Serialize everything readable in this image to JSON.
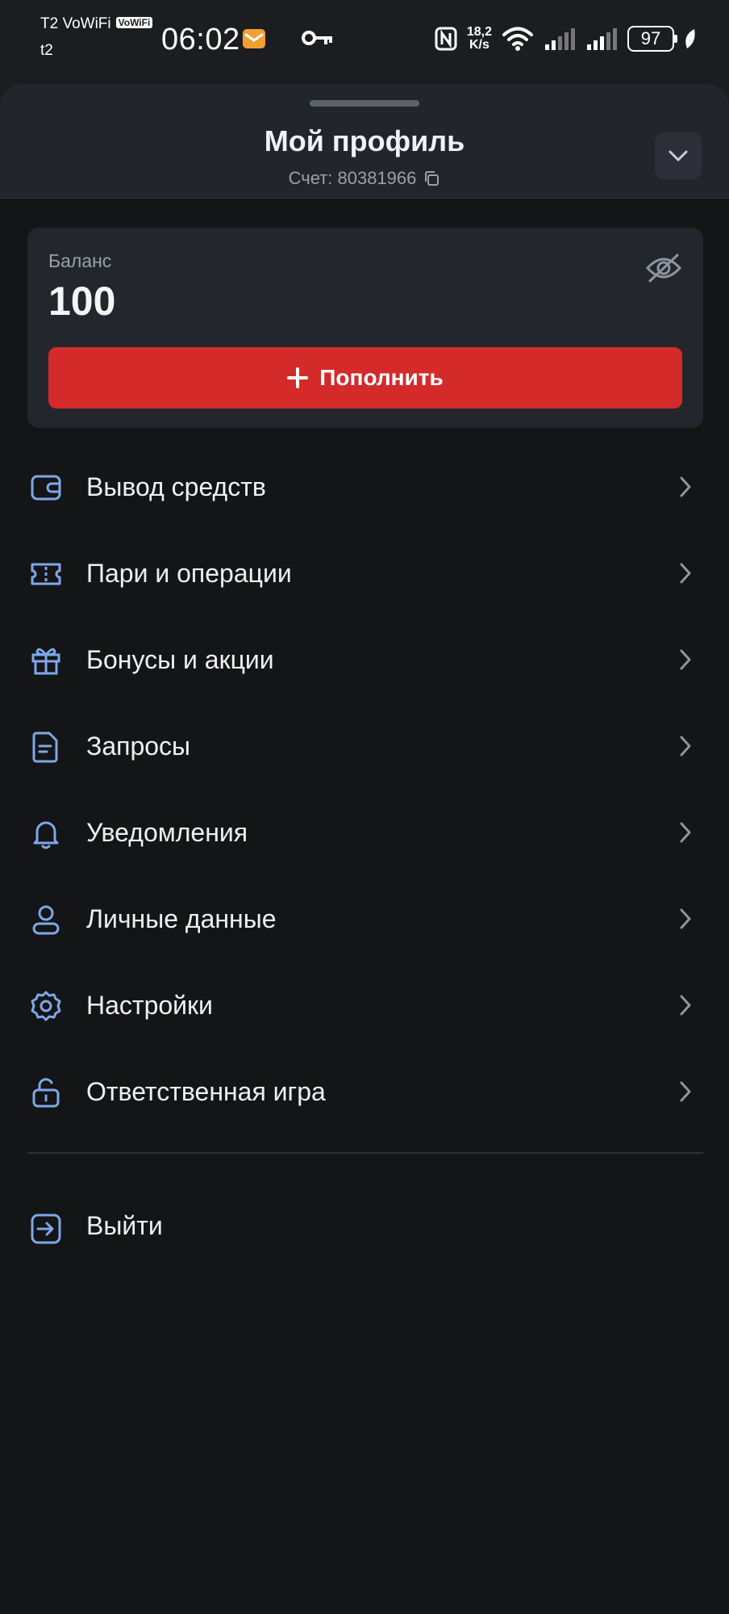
{
  "status_bar": {
    "carrier_line1": "T2 VoWiFi",
    "vowifi_badge": "VoWiFi",
    "carrier_line2": "t2",
    "time": "06:02",
    "net_speed_value": "18,2",
    "net_speed_unit": "K/s",
    "battery": "97",
    "icons": [
      "mail-notification-icon",
      "vpn-key-icon",
      "nfc-icon",
      "wifi-icon",
      "signal-icon",
      "signal-icon",
      "battery-icon",
      "leaf-icon"
    ]
  },
  "header": {
    "title": "Мой профиль",
    "account_label": "Счет: 80381966"
  },
  "balance": {
    "label": "Баланс",
    "value": "100",
    "topup_label": "Пополнить"
  },
  "menu": [
    {
      "label": "Вывод средств",
      "icon": "wallet-icon"
    },
    {
      "label": "Пари и операции",
      "icon": "ticket-icon"
    },
    {
      "label": "Бонусы и акции",
      "icon": "gift-icon"
    },
    {
      "label": "Запросы",
      "icon": "document-icon"
    },
    {
      "label": "Уведомления",
      "icon": "bell-icon"
    },
    {
      "label": "Личные данные",
      "icon": "user-icon"
    },
    {
      "label": "Настройки",
      "icon": "gear-icon"
    },
    {
      "label": "Ответственная игра",
      "icon": "unlock-icon"
    }
  ],
  "logout": {
    "label": "Выйти",
    "icon": "logout-icon"
  },
  "colors": {
    "accent_red": "#d42a2a",
    "icon_blue": "#7ea8e8",
    "background": "#141517",
    "card": "#23262d"
  }
}
